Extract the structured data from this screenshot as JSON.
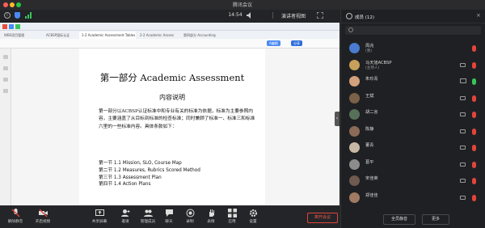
{
  "window": {
    "title": "腾讯会议"
  },
  "meeting_bar": {
    "timer": "14:54",
    "view_label": "演讲者视图"
  },
  "document": {
    "title": "第一部分 Academic Assessment",
    "subtitle": "内容说明",
    "paragraph": "第一部分以ACBSP认证标准中和专业有关的标准为依据，标准为主要参照内容，主要涵盖了从目标到标准的检查标准；同时兼顾了标准一、标准三和标准六里的一些标准内容。具体条款如下：",
    "items": [
      "第一节 1.1 Mission, SLO, Course Map",
      "第二节 1.2 Measures, Rubrics Scored Method",
      "第三节 1.3 Assessment Plan",
      "第四节 1.4 Action Plans"
    ],
    "ribbon_button_1": "A编辑",
    "ribbon_button_2": "分享",
    "tabs": [
      "WBS项目管理",
      "ACBSP国际认证",
      "1-2 Academic Assessment Tables",
      "2-2 Academic Assess",
      "第四部分 Accounting"
    ]
  },
  "toolbar": {
    "mute_label": "解除静音",
    "video_label": "开启视频",
    "share_label": "共享屏幕",
    "invite_label": "邀请",
    "members_label": "管理成员",
    "chat_label": "聊天",
    "record_label": "录制",
    "reaction_label": "表情",
    "apps_label": "应用",
    "settings_label": "设置",
    "end_label": "离开会议"
  },
  "panel": {
    "title": "成员 (12)",
    "participants": [
      {
        "name": "周兆",
        "role": "(我)",
        "avatar_color": "#4a7bd0",
        "mic": "muted"
      },
      {
        "name": "马天旭ACBSP",
        "role": "(主持人)",
        "avatar_color": "#c7a15a",
        "mic": "muted"
      },
      {
        "name": "朱珍青",
        "role": "",
        "avatar_color": "#d2a07c",
        "mic": "active"
      },
      {
        "name": "王斌",
        "role": "",
        "avatar_color": "#7b6148",
        "mic": "muted"
      },
      {
        "name": "胡二言",
        "role": "",
        "avatar_color": "#57705a",
        "mic": "muted"
      },
      {
        "name": "陈静",
        "role": "",
        "avatar_color": "#8b6a58",
        "mic": "muted"
      },
      {
        "name": "董青",
        "role": "",
        "avatar_color": "#c9b7a6",
        "mic": "muted"
      },
      {
        "name": "葛平",
        "role": "",
        "avatar_color": "#8c8c8c",
        "mic": "muted"
      },
      {
        "name": "宋佳荣",
        "role": "",
        "avatar_color": "#6e5a4f",
        "mic": "muted"
      },
      {
        "name": "郑佳佳",
        "role": "",
        "avatar_color": "#a07a63",
        "mic": "muted"
      }
    ],
    "mute_all_label": "全员静音",
    "more_label": "更多"
  },
  "colors": {
    "accent": "#4a8af4",
    "danger": "#e2443a",
    "mic_active": "#38c45a"
  }
}
